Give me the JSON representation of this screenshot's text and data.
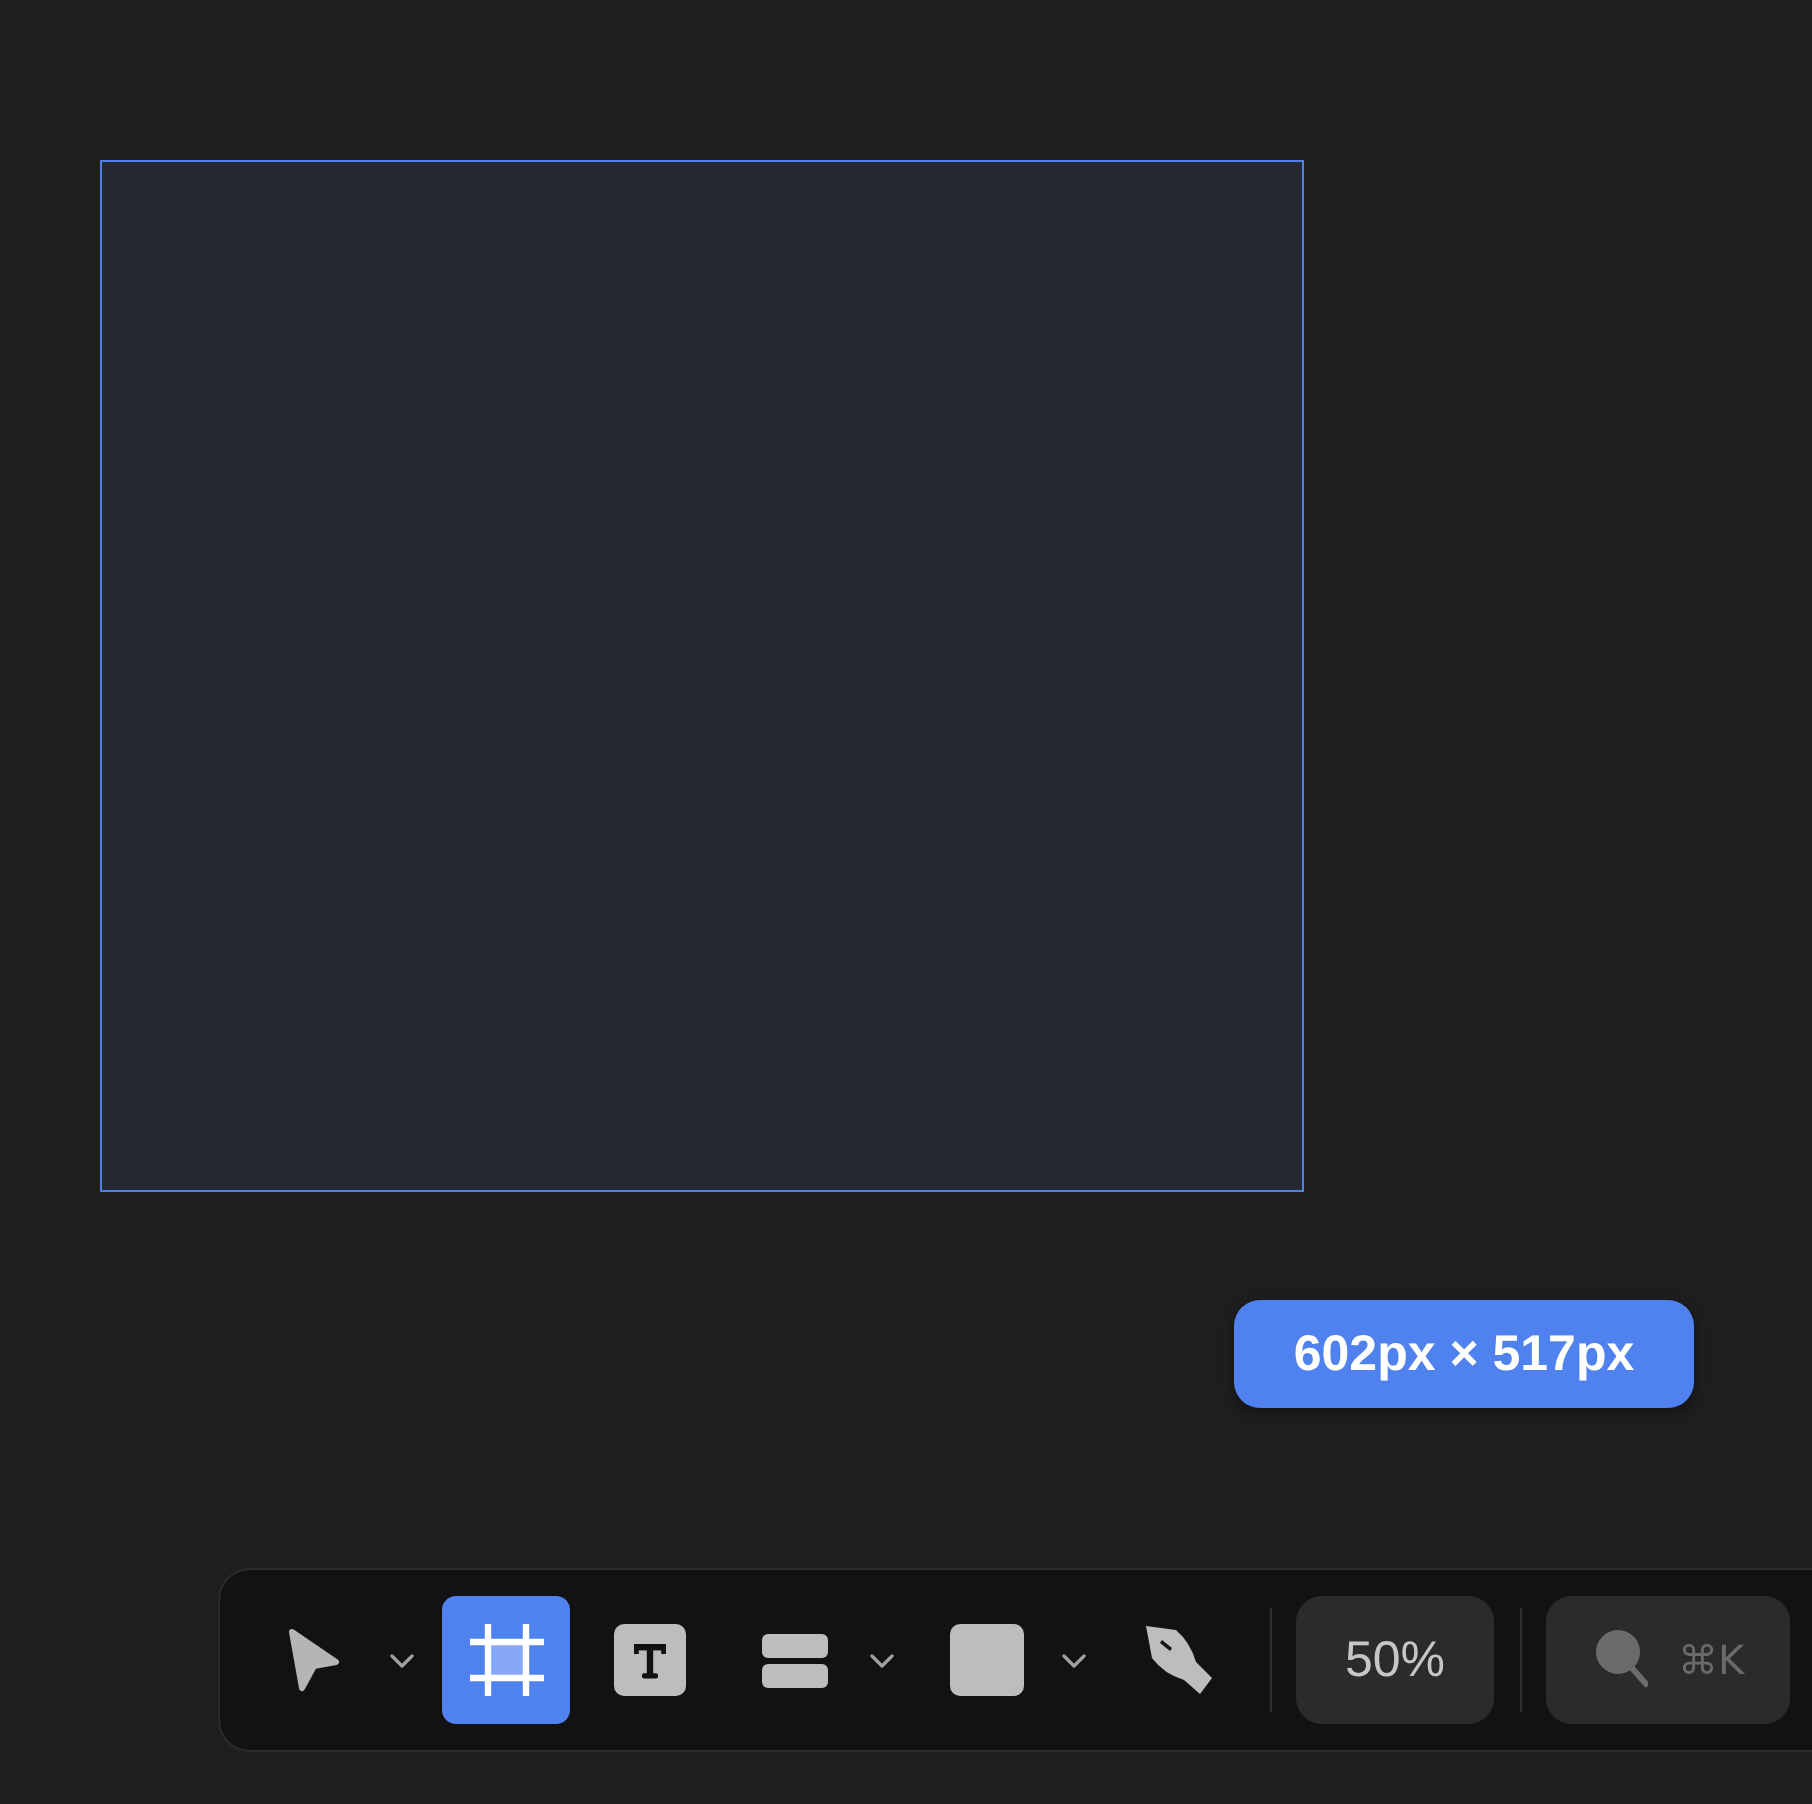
{
  "canvas": {
    "frame": {
      "selected": true
    },
    "size_badge": "602px × 517px"
  },
  "toolbar": {
    "tools": [
      {
        "kind": "pointer",
        "selected": false,
        "has_menu": true
      },
      {
        "kind": "frame",
        "selected": true,
        "has_menu": false
      },
      {
        "kind": "text",
        "selected": false,
        "has_menu": false
      },
      {
        "kind": "stack",
        "selected": false,
        "has_menu": true
      },
      {
        "kind": "rectangle",
        "selected": false,
        "has_menu": true
      },
      {
        "kind": "pen",
        "selected": false,
        "has_menu": false
      }
    ],
    "zoom": "50%",
    "search": {
      "shortcut": "⌘K"
    }
  }
}
